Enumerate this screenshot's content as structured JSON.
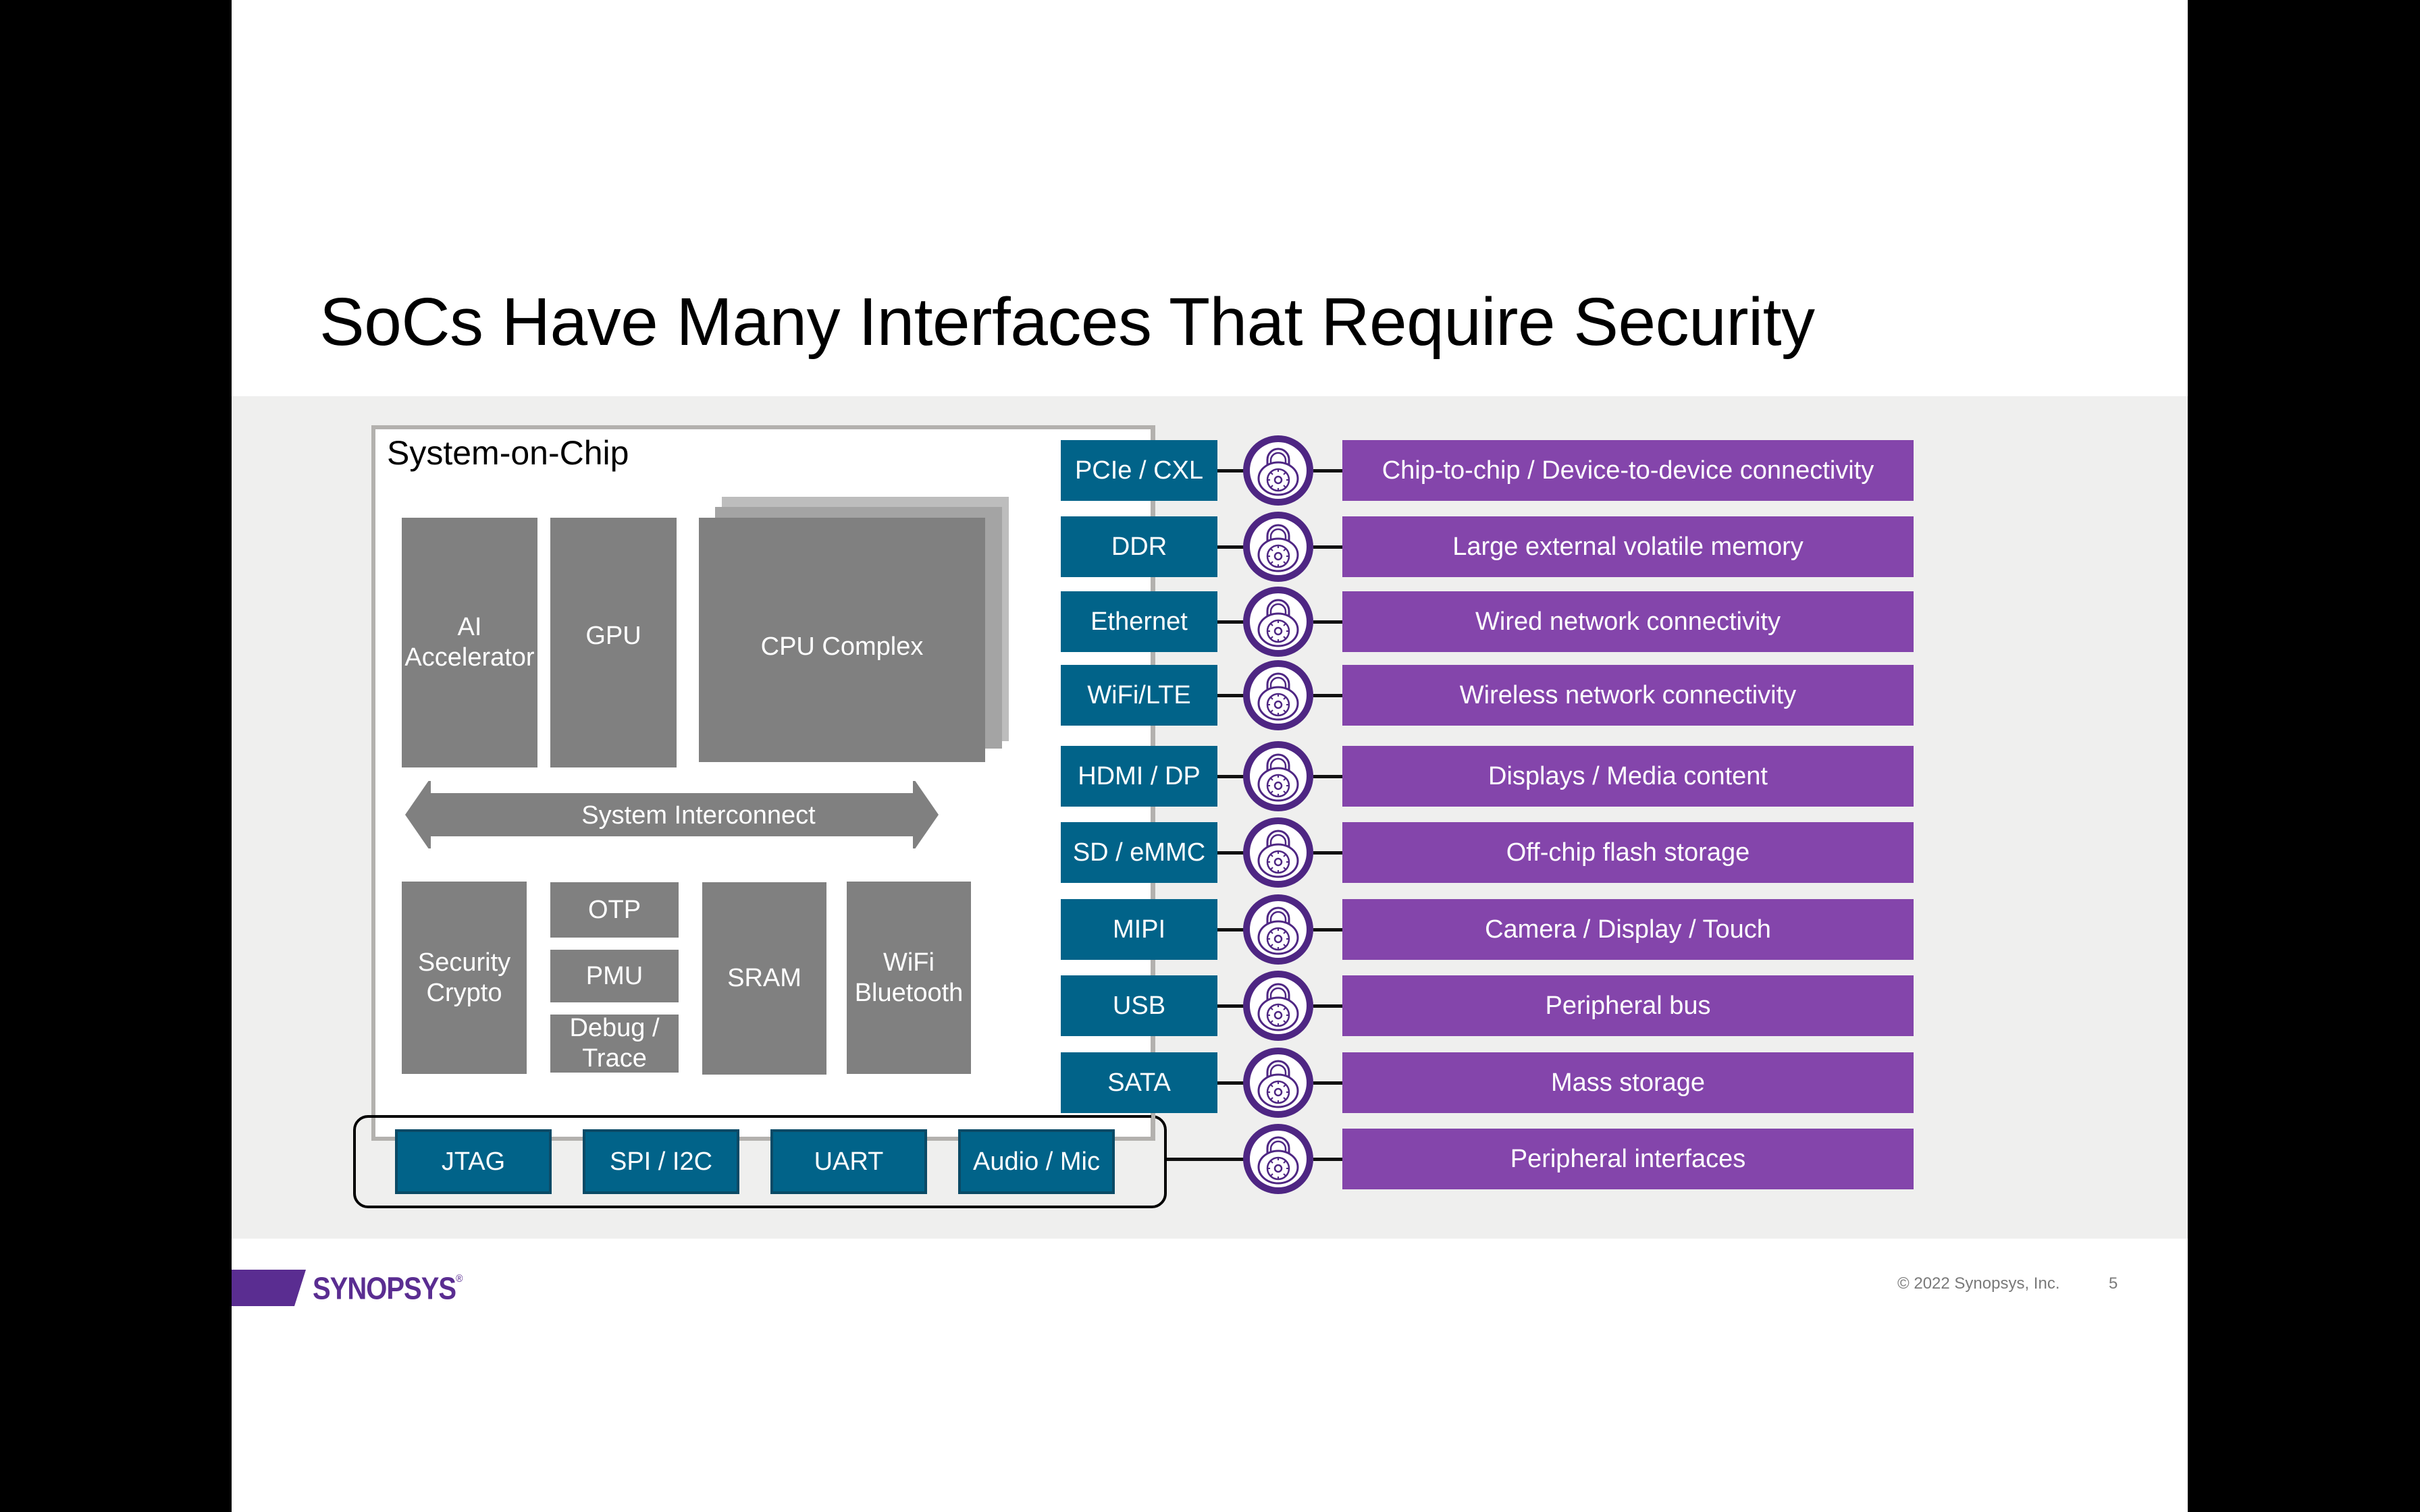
{
  "slide": {
    "title": "SoCs Have Many Interfaces That Require Security",
    "page_number": "5",
    "copyright": "© 2022 Synopsys, Inc.",
    "logo": {
      "text": "SYNOPSYS",
      "registered": "®"
    }
  },
  "colors": {
    "interface_blue": "#016389",
    "description_purple": "#8445ab",
    "lock_ring_purple": "#4e2683",
    "block_gray": "#808080",
    "band_gray": "#efefee",
    "brand_purple": "#5a2d91"
  },
  "soc": {
    "label": "System-on-Chip",
    "top_blocks": [
      {
        "label_lines": [
          "AI",
          "Accelerator"
        ]
      },
      {
        "label_lines": [
          "GPU"
        ]
      },
      {
        "label_lines": [
          "CPU Complex"
        ]
      }
    ],
    "interconnect_label": "System Interconnect",
    "bottom_blocks": {
      "security": [
        "Security",
        "Crypto"
      ],
      "otp": "OTP",
      "pmu": "PMU",
      "debug": [
        "Debug /",
        "Trace"
      ],
      "sram": "SRAM",
      "wifi": [
        "WiFi",
        "Bluetooth"
      ]
    }
  },
  "interfaces": [
    {
      "label": "PCIe / CXL",
      "description": "Chip-to-chip / Device-to-device connectivity",
      "icon": "padlock-icon"
    },
    {
      "label": "DDR",
      "description": "Large external volatile memory",
      "icon": "padlock-icon"
    },
    {
      "label": "Ethernet",
      "description": "Wired network connectivity",
      "icon": "padlock-icon"
    },
    {
      "label": "WiFi/LTE",
      "description": "Wireless network connectivity",
      "icon": "padlock-icon"
    },
    {
      "label": "HDMI / DP",
      "description": "Displays / Media content",
      "icon": "padlock-icon"
    },
    {
      "label": "SD / eMMC",
      "description": "Off-chip flash storage",
      "icon": "padlock-icon"
    },
    {
      "label": "MIPI",
      "description": "Camera / Display / Touch",
      "icon": "padlock-icon"
    },
    {
      "label": "USB",
      "description": "Peripheral bus",
      "icon": "padlock-icon"
    },
    {
      "label": "SATA",
      "description": "Mass storage",
      "icon": "padlock-icon"
    }
  ],
  "peripheral_group": {
    "items": [
      "JTAG",
      "SPI / I2C",
      "UART",
      "Audio / Mic"
    ],
    "description": "Peripheral interfaces",
    "icon": "padlock-icon"
  }
}
